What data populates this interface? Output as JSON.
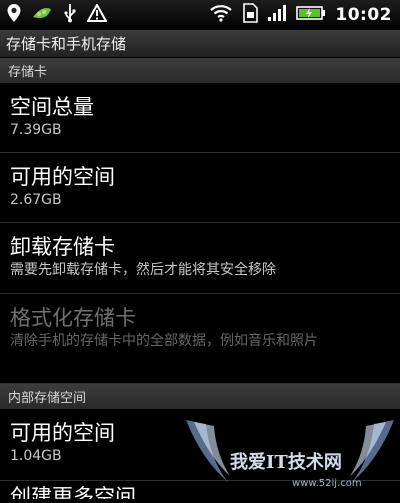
{
  "status_bar": {
    "time": "10:02",
    "icons": [
      "location-pin-icon",
      "pea-app-icon",
      "usb-icon",
      "warning-icon",
      "wifi-icon",
      "sim-card-icon",
      "signal-icon",
      "battery-icon"
    ],
    "battery_color": "#59c22a"
  },
  "title_bar": {
    "title": "存储卡和手机存储"
  },
  "sections": {
    "sd_card": {
      "header": "存储卡",
      "total_space": {
        "title": "空间总量",
        "value": "7.39GB"
      },
      "available_space": {
        "title": "可用的空间",
        "value": "2.67GB"
      },
      "unmount": {
        "title": "卸载存储卡",
        "summary": "需要先卸载存储卡，然后才能将其安全移除"
      },
      "format": {
        "title": "格式化存储卡",
        "summary": "清除手机的存储卡中的全部数据，例如音乐和照片"
      }
    },
    "internal": {
      "header": "内部存储空间",
      "available_space": {
        "title": "可用的空间",
        "value": "1.04GB"
      },
      "next_item": {
        "title": "创建更多空间"
      }
    }
  },
  "watermark": {
    "text": "我爱IT技术网",
    "url": "www.52ij.com"
  }
}
